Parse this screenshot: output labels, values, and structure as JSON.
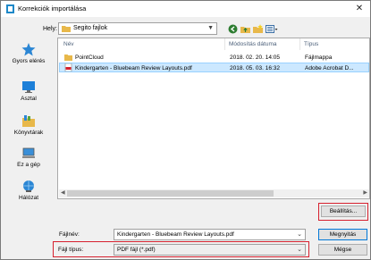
{
  "window": {
    "title": "Korrekciók importálása",
    "close_glyph": "✕"
  },
  "location": {
    "label": "Hely:",
    "value": "Segito fajlok"
  },
  "places": [
    {
      "label": "Gyors elérés",
      "icon": "star-icon"
    },
    {
      "label": "Asztal",
      "icon": "desktop-icon"
    },
    {
      "label": "Könyvtárak",
      "icon": "libraries-icon"
    },
    {
      "label": "Ez a gép",
      "icon": "computer-icon"
    },
    {
      "label": "Hálózat",
      "icon": "network-icon"
    }
  ],
  "columns": {
    "name": "Név",
    "date": "Módosítás dátuma",
    "type": "Típus"
  },
  "files": [
    {
      "name": "PointCloud",
      "date": "2018. 02. 20. 14:05",
      "type": "Fájlmappa",
      "icon": "folder-icon",
      "selected": false
    },
    {
      "name": "Kindergarten - Bluebeam Review Layouts.pdf",
      "date": "2018. 05. 03. 16:32",
      "type": "Adobe Acrobat D...",
      "icon": "pdf-icon",
      "selected": true
    }
  ],
  "buttons": {
    "settings": "Beállítás...",
    "open": "Megnyitás",
    "cancel": "Mégse"
  },
  "filename": {
    "label": "Fájlnév:",
    "value": "Kindergarten - Bluebeam Review Layouts.pdf"
  },
  "filetype": {
    "label": "Fájl típus:",
    "value": "PDF fájl (*.pdf)"
  },
  "colors": {
    "highlight": "#d6202e",
    "selection": "#cce8ff",
    "accent": "#0078d7"
  }
}
